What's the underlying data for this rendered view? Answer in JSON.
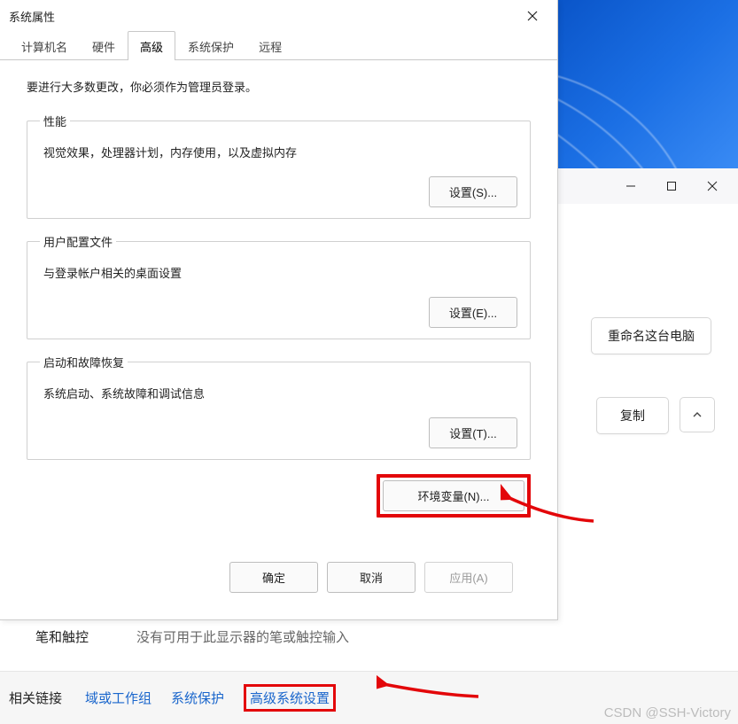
{
  "dialog": {
    "title": "系统属性",
    "tabs": [
      "计算机名",
      "硬件",
      "高级",
      "系统保护",
      "远程"
    ],
    "active_tab_index": 2,
    "intro": "要进行大多数更改，你必须作为管理员登录。",
    "perf": {
      "legend": "性能",
      "desc": "视觉效果，处理器计划，内存使用，以及虚拟内存",
      "button": "设置(S)..."
    },
    "profile": {
      "legend": "用户配置文件",
      "desc": "与登录帐户相关的桌面设置",
      "button": "设置(E)..."
    },
    "startup": {
      "legend": "启动和故障恢复",
      "desc": "系统启动、系统故障和调试信息",
      "button": "设置(T)..."
    },
    "env_button": "环境变量(N)...",
    "footer": {
      "ok": "确定",
      "cancel": "取消",
      "apply": "应用(A)"
    }
  },
  "settings": {
    "rename": "重命名这台电脑",
    "copy": "复制"
  },
  "pen_row": {
    "label": "笔和触控",
    "value": "没有可用于此显示器的笔或触控输入"
  },
  "links": {
    "head": "相关链接",
    "items": [
      "域或工作组",
      "系统保护",
      "高级系统设置"
    ]
  },
  "watermark": "CSDN @SSH-Victory"
}
